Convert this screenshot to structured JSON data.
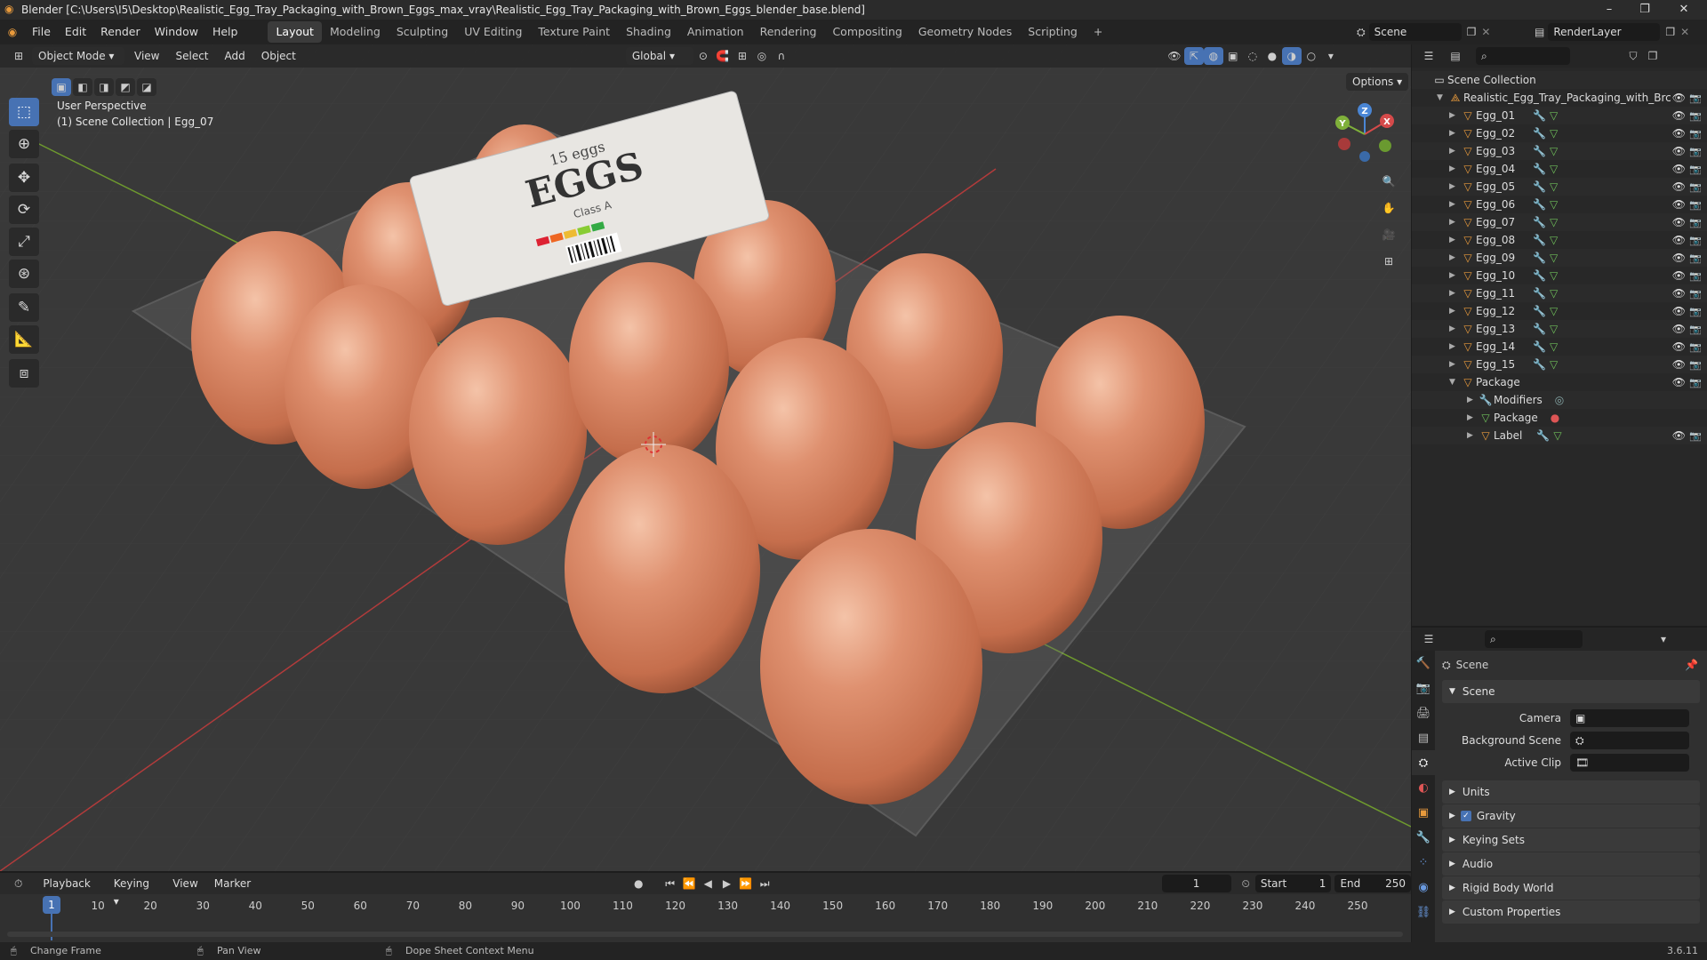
{
  "window": {
    "title": "Blender [C:\\Users\\I5\\Desktop\\Realistic_Egg_Tray_Packaging_with_Brown_Eggs_max_vray\\Realistic_Egg_Tray_Packaging_with_Brown_Eggs_blender_base.blend]"
  },
  "menu": [
    "File",
    "Edit",
    "Render",
    "Window",
    "Help"
  ],
  "workspaces": [
    "Layout",
    "Modeling",
    "Sculpting",
    "UV Editing",
    "Texture Paint",
    "Shading",
    "Animation",
    "Rendering",
    "Compositing",
    "Geometry Nodes",
    "Scripting"
  ],
  "active_workspace": "Layout",
  "scene_field": "Scene",
  "viewlayer_field": "RenderLayer",
  "viewport": {
    "mode": "Object Mode",
    "menus": [
      "View",
      "Select",
      "Add",
      "Object"
    ],
    "transform": "Global",
    "options": "Options",
    "perspective": "User Perspective",
    "collection_info": "(1) Scene Collection | Egg_07",
    "gizmo": {
      "x": "X",
      "y": "Y",
      "z": "Z"
    }
  },
  "outliner": {
    "root": "Scene Collection",
    "collection": "Realistic_Egg_Tray_Packaging_with_Brc",
    "eggs": [
      "Egg_01",
      "Egg_02",
      "Egg_03",
      "Egg_04",
      "Egg_05",
      "Egg_06",
      "Egg_07",
      "Egg_08",
      "Egg_09",
      "Egg_10",
      "Egg_11",
      "Egg_12",
      "Egg_13",
      "Egg_14",
      "Egg_15"
    ],
    "package": "Package",
    "package_children": [
      "Modifiers",
      "Package",
      "Label"
    ]
  },
  "properties": {
    "header": "Scene",
    "panel": "Scene",
    "camera_label": "Camera",
    "background_label": "Background Scene",
    "clip_label": "Active Clip",
    "sections": [
      "Units",
      "Gravity",
      "Keying Sets",
      "Audio",
      "Rigid Body World",
      "Custom Properties"
    ]
  },
  "timeline": {
    "menus": [
      "Playback",
      "Keying",
      "View",
      "Marker"
    ],
    "current": "1",
    "start_label": "Start",
    "start": "1",
    "end_label": "End",
    "end": "250",
    "ticks": [
      "1",
      "10",
      "20",
      "30",
      "40",
      "50",
      "60",
      "70",
      "80",
      "90",
      "100",
      "110",
      "120",
      "130",
      "140",
      "150",
      "160",
      "170",
      "180",
      "190",
      "200",
      "210",
      "220",
      "230",
      "240",
      "250"
    ]
  },
  "status": {
    "left": "Change Frame",
    "mid": "Pan View",
    "right": "Dope Sheet Context Menu",
    "version": "3.6.11"
  },
  "label_text": {
    "eggs_big": "EGGS",
    "count": "15 eggs",
    "class": "Class A"
  },
  "colors": {
    "accent": "#4772b3",
    "egg": "#d98862",
    "x_axis": "#d54a4a",
    "y_axis": "#7fb03a",
    "z_axis": "#4a86d5",
    "icon_orange": "#e89a3c",
    "icon_green": "#6fbf5a"
  }
}
